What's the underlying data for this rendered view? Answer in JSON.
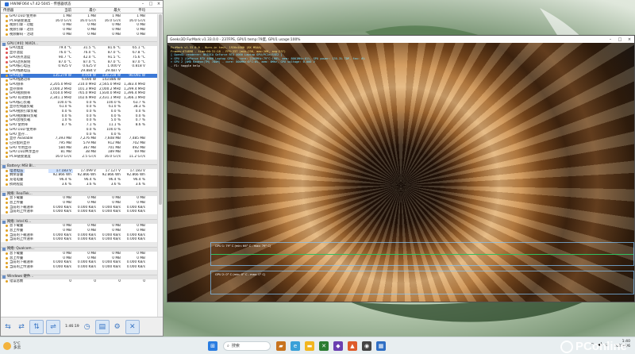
{
  "hwinfo": {
    "title": "HWiNFO64 v7.42-5045 - 传感器状态",
    "columns": [
      "传感器",
      "当前",
      "最小",
      "最大",
      "平均"
    ],
    "top_rows": [
      [
        "GPU D3D 使用率",
        "1 MB",
        "1 MB",
        "1 MB",
        "1 MB"
      ],
      [
        "PCIe链接速度",
        "16.0 GT/s",
        "16.0 GT/s",
        "16.0 GT/s",
        "16.0 GT/s"
      ],
      [
        "视频引擎 - 功能",
        "0 MB",
        "0 MB",
        "0 MB",
        "0 MB"
      ],
      [
        "视频引擎 - 过热",
        "0 MB",
        "0 MB",
        "0 MB",
        "0 MB"
      ],
      [
        "视频解码 - 活动",
        "0 MB",
        "0 MB",
        "0 MB",
        "0 MB"
      ]
    ],
    "gpu_group": "GPU [#0]: NVIDI...",
    "gpu_rows": [
      [
        "GPU温度",
        "79.4 °C",
        "31.5 °C",
        "81.6 °C",
        "65.1 °C",
        "t"
      ],
      [
        "显存温度",
        "76.0 °C",
        "76.0 °C",
        "87.0 °C",
        "67.8 °C",
        "t"
      ],
      [
        "GPU热点温度",
        "90.7 °C",
        "42.0 °C",
        "91.5 °C",
        "75.6 °C",
        "t"
      ],
      [
        "GPU过热限制",
        "87.0 °C",
        "87.0 °C",
        "87.0 °C",
        "87.0 °C",
        "t"
      ],
      [
        "GPU核心电压",
        "0.925 V",
        "0.625 V",
        "1.000 V",
        "0.818 V",
        ""
      ],
      [
        "GPU线路电压",
        "",
        "29.884 V",
        "29.487 V",
        "",
        ""
      ],
      [
        "GPU功率",
        "135.279 W",
        "4.058 W",
        "136.238 W",
        "90.091 W",
        "sel"
      ],
      [
        "GPU线路功率",
        "",
        "6.000 W",
        "143.886 W",
        "",
        ""
      ],
      [
        "GPU频率",
        "2,205.0 MHz",
        "210.0 MHz",
        "2,565.0 MHz",
        "1,383.4 MHz",
        ""
      ],
      [
        "显存频率",
        "2,000.2 MHz",
        "101.3 MHz",
        "2,000.2 MHz",
        "1,299.4 MHz",
        ""
      ],
      [
        "GPU视频频率",
        "1,650.0 MHz",
        "765.0 MHz",
        "1,830.0 MHz",
        "1,396.4 MHz",
        ""
      ],
      [
        "GPU 有效频率",
        "2,341.1 MHz",
        "102.6 MHz",
        "2,431.1 MHz",
        "1,366.1 MHz",
        ""
      ],
      [
        "GPU核心负载",
        "100.0 %",
        "0.0 %",
        "100.0 %",
        "63.7 %",
        ""
      ],
      [
        "显存控制器负载",
        "61.0 %",
        "0.0 %",
        "61.0 %",
        "38.3 %",
        ""
      ],
      [
        "GPU视频引擎负载",
        "0.0 %",
        "0.0 %",
        "0.0 %",
        "0.0 %",
        ""
      ],
      [
        "GPU视频解码负载",
        "0.0 %",
        "0.0 %",
        "0.0 %",
        "0.0 %",
        ""
      ],
      [
        "GPU总线负载",
        "1.0 %",
        "0.0 %",
        "5.0 %",
        "0.7 %",
        ""
      ],
      [
        "GPU 使用率",
        "8.7 %",
        "7.1 %",
        "11.1 %",
        "8.6 %",
        ""
      ],
      [
        "GPU D3D 使用率",
        "",
        "0.0 %",
        "100.0 %",
        "",
        ""
      ],
      [
        "GPU 显存...",
        "",
        "0.0 %",
        "0.0 %",
        "",
        ""
      ],
      [
        "显存 Available",
        "7,393 MB",
        "7,276 MB",
        "7,608 MB",
        "7,485 MB",
        ""
      ],
      [
        "已分配的显存",
        "795 MB",
        "579 MB",
        "912 MB",
        "702 MB",
        ""
      ],
      [
        "GPU 专用显存",
        "584 MB",
        "367 MB",
        "701 MB",
        "492 MB",
        ""
      ],
      [
        "GPU D3D共享显存",
        "81 MB",
        "38 MB",
        "189 MB",
        "69 MB",
        ""
      ],
      [
        "PCIe链接速度",
        "16.0 GT/s",
        "2.5 GT/s",
        "16.0 GT/s",
        "11.2 GT/s",
        ""
      ]
    ],
    "battery_group": "Battery: MSI BI...",
    "battery_rows": [
      [
        "电池电压",
        "17.183 V",
        "17.099 V",
        "17.127 V",
        "17.183 V",
        "hl"
      ],
      [
        "剩余容量",
        "92.866 Wh",
        "92.866 Wh",
        "92.866 Wh",
        "92.866 Wh",
        ""
      ],
      [
        "充电电量",
        "96.4 %",
        "96.4 %",
        "96.4 %",
        "96.4 %",
        ""
      ],
      [
        "损耗程度",
        "3.6 %",
        "3.6 %",
        "3.6 %",
        "3.6 %",
        ""
      ]
    ],
    "net_groups": [
      {
        "name": "网络: RealTek...",
        "rows": [
          [
            "总下载量",
            "0 MB",
            "0 MB",
            "0 MB",
            "0 MB"
          ],
          [
            "总上传量",
            "0 MB",
            "0 MB",
            "0 MB",
            "0 MB"
          ],
          [
            "当前的下载速率",
            "0.000 KB/s",
            "0.000 KB/s",
            "0.000 KB/s",
            "0.000 KB/s"
          ],
          [
            "当前的上传速率",
            "0.000 KB/s",
            "0.000 KB/s",
            "0.000 KB/s",
            "0.000 KB/s"
          ]
        ]
      },
      {
        "name": "网络: Intel Ki...",
        "rows": [
          [
            "总下载量",
            "0 MB",
            "0 MB",
            "0 MB",
            "0 MB"
          ],
          [
            "总上传量",
            "0 MB",
            "0 MB",
            "0 MB",
            "0 MB"
          ],
          [
            "当前的下载速率",
            "0.000 KB/s",
            "0.000 KB/s",
            "0.000 KB/s",
            "0.000 KB/s"
          ],
          [
            "当前的上传速率",
            "0.000 KB/s",
            "0.000 KB/s",
            "0.000 KB/s",
            "0.000 KB/s"
          ]
        ]
      },
      {
        "name": "网络: Qualcom...",
        "rows": [
          [
            "总下载量",
            "0 MB",
            "0 MB",
            "0 MB",
            "0 MB"
          ],
          [
            "总上传量",
            "0 MB",
            "0 MB",
            "0 MB",
            "0 MB"
          ],
          [
            "当前的下载速率",
            "0.000 KB/s",
            "0.000 KB/s",
            "0.000 KB/s",
            "0.000 KB/s"
          ],
          [
            "当前的上传速率",
            "0.000 KB/s",
            "0.000 KB/s",
            "0.000 KB/s",
            "0.000 KB/s"
          ]
        ]
      }
    ],
    "hw_group": "Windows 硬件...",
    "hw_rows": [
      [
        "错误总数",
        "0",
        "0",
        "0",
        "0"
      ]
    ],
    "timer": "1:46:19"
  },
  "furmark": {
    "title": "Geeks3D FurMark v1.33.0.0 - 237FPS, GPU1 temp:79度, GPU1 usage:100%",
    "osd": [
      "FurMark v1.33.0.0 - Burn-in test, 1920x1080 (8X MSAA)",
      "Frames:474898 - time:00:31:18 - FPS:237 (min:236, max:266, avg:237)",
      "[ OpenGL renderer: NVIDIA GeForce RTX 4060 Laptop GPU/PCIe/SSE2 ]",
      "> GPU 1 (GeForce RTX 4060 Laptop GPU) - core: 2205MHz:79°C:100%, mem: 8001MHz:61%, GPU power: 135.3% TDP, fan: 0%",
      "> GPU 2 (AMD Radeon(TM) 780M) - core: 800MHz:0°C:0%, mem: 0MHz, GPU voltage: 0.000 V",
      "- F1: toggle help"
    ],
    "graph1_label": "GPU 1: 79° C (min: 66° C - max: 79° C)",
    "graph2_label": "GPU 2: 0° C (min: 0° C - max: 0° C)"
  },
  "taskbar": {
    "weather_temp": "5°C",
    "weather_text": "多云",
    "search_placeholder": "搜索",
    "time": "1:40",
    "date": "2023/6/6"
  },
  "watermark": "PConline"
}
